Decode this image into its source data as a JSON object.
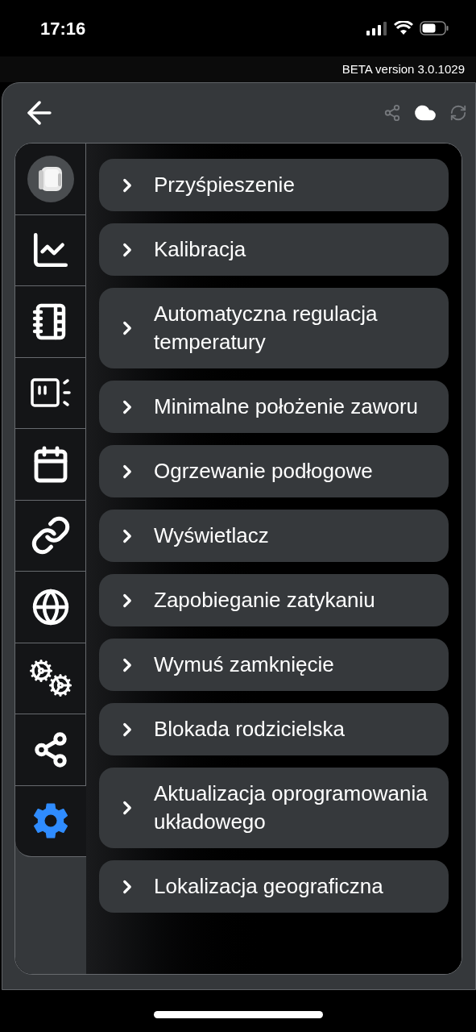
{
  "status_bar": {
    "time": "17:16"
  },
  "version": "BETA version 3.0.1029",
  "sidebar": {
    "tabs": [
      {
        "selected": false
      },
      {
        "selected": false
      },
      {
        "selected": false
      },
      {
        "selected": false
      },
      {
        "selected": false
      },
      {
        "selected": false
      },
      {
        "selected": false
      },
      {
        "selected": false
      },
      {
        "selected": false
      },
      {
        "selected": true
      }
    ]
  },
  "menu": [
    {
      "label": "Przyśpieszenie",
      "expanded": false
    },
    {
      "label": "Kalibracja",
      "expanded": false
    },
    {
      "label": "Automatyczna regulacja temperatury",
      "expanded": false
    },
    {
      "label": "Minimalne położenie zaworu",
      "expanded": false
    },
    {
      "label": "Ogrzewanie podłogowe",
      "expanded": false
    },
    {
      "label": "Wyświetlacz",
      "expanded": false
    },
    {
      "label": "Zapobieganie zatykaniu",
      "expanded": false
    },
    {
      "label": "Wymuś zamknięcie",
      "expanded": false
    },
    {
      "label": "Blokada rodzicielska",
      "expanded": false
    },
    {
      "label": "Aktualizacja oprogramowania układowego",
      "expanded": false
    },
    {
      "label": "Lokalizacja geograficzna",
      "expanded": false
    }
  ]
}
